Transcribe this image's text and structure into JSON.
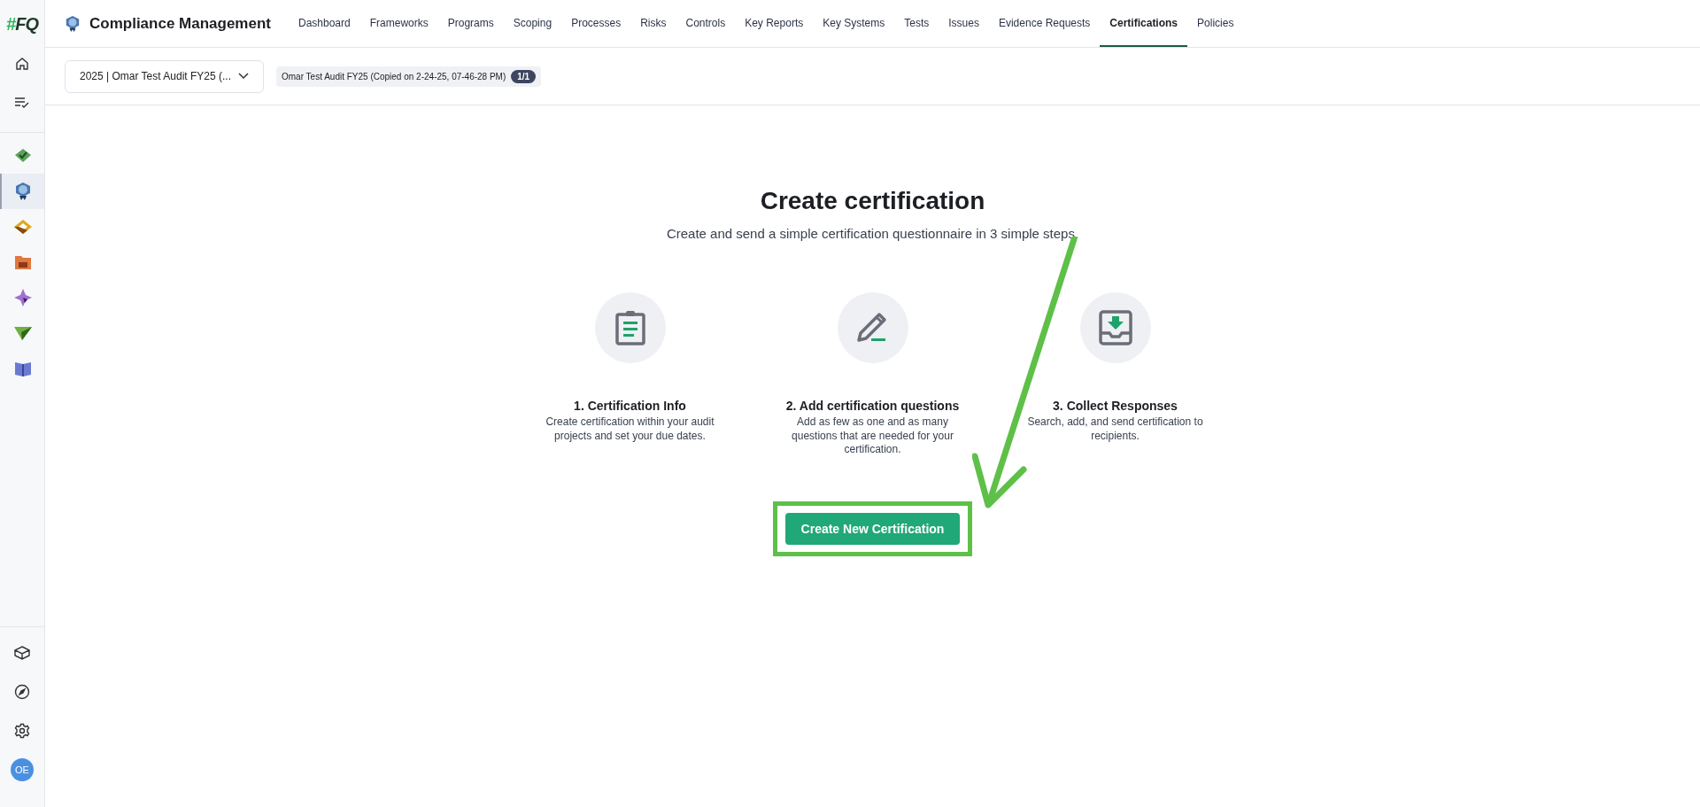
{
  "logo": {
    "mark": "#",
    "text": "FQ"
  },
  "sidebar": {
    "apps": [
      {
        "kind": "check-stack",
        "selected": false
      },
      {
        "kind": "badge",
        "selected": true
      },
      {
        "kind": "rings",
        "selected": false
      },
      {
        "kind": "folder",
        "selected": false
      },
      {
        "kind": "sparkle",
        "selected": false
      },
      {
        "kind": "plane",
        "selected": false
      },
      {
        "kind": "book",
        "selected": false
      }
    ],
    "avatar": "OE"
  },
  "header": {
    "title": "Compliance Management",
    "tabs": [
      {
        "label": "Dashboard",
        "selected": false
      },
      {
        "label": "Frameworks",
        "selected": false
      },
      {
        "label": "Programs",
        "selected": false
      },
      {
        "label": "Scoping",
        "selected": false
      },
      {
        "label": "Processes",
        "selected": false
      },
      {
        "label": "Risks",
        "selected": false
      },
      {
        "label": "Controls",
        "selected": false
      },
      {
        "label": "Key Reports",
        "selected": false
      },
      {
        "label": "Key Systems",
        "selected": false
      },
      {
        "label": "Tests",
        "selected": false
      },
      {
        "label": "Issues",
        "selected": false
      },
      {
        "label": "Evidence Requests",
        "selected": false
      },
      {
        "label": "Certifications",
        "selected": true
      },
      {
        "label": "Policies",
        "selected": false
      }
    ]
  },
  "toolbar": {
    "audit_select": "2025 | Omar Test Audit FY25 (...",
    "audit_chip": "Omar Test Audit FY25 (Copied on 2-24-25, 07-46-28 PM)",
    "count_badge": "1/1"
  },
  "main": {
    "title": "Create certification",
    "subtitle": "Create and send a simple certification questionnaire in 3 simple steps.",
    "steps": [
      {
        "kind": "clipboard",
        "title": "1. Certification Info",
        "description": "Create certification within your audit projects and set your due dates."
      },
      {
        "kind": "pencil",
        "title": "2. Add certification questions",
        "description": "Add as few as one and as many questions that are needed for your certification."
      },
      {
        "kind": "inbox",
        "title": "3. Collect Responses",
        "description": "Search, add, and send certification to recipients."
      }
    ],
    "button": "Create New Certification"
  }
}
